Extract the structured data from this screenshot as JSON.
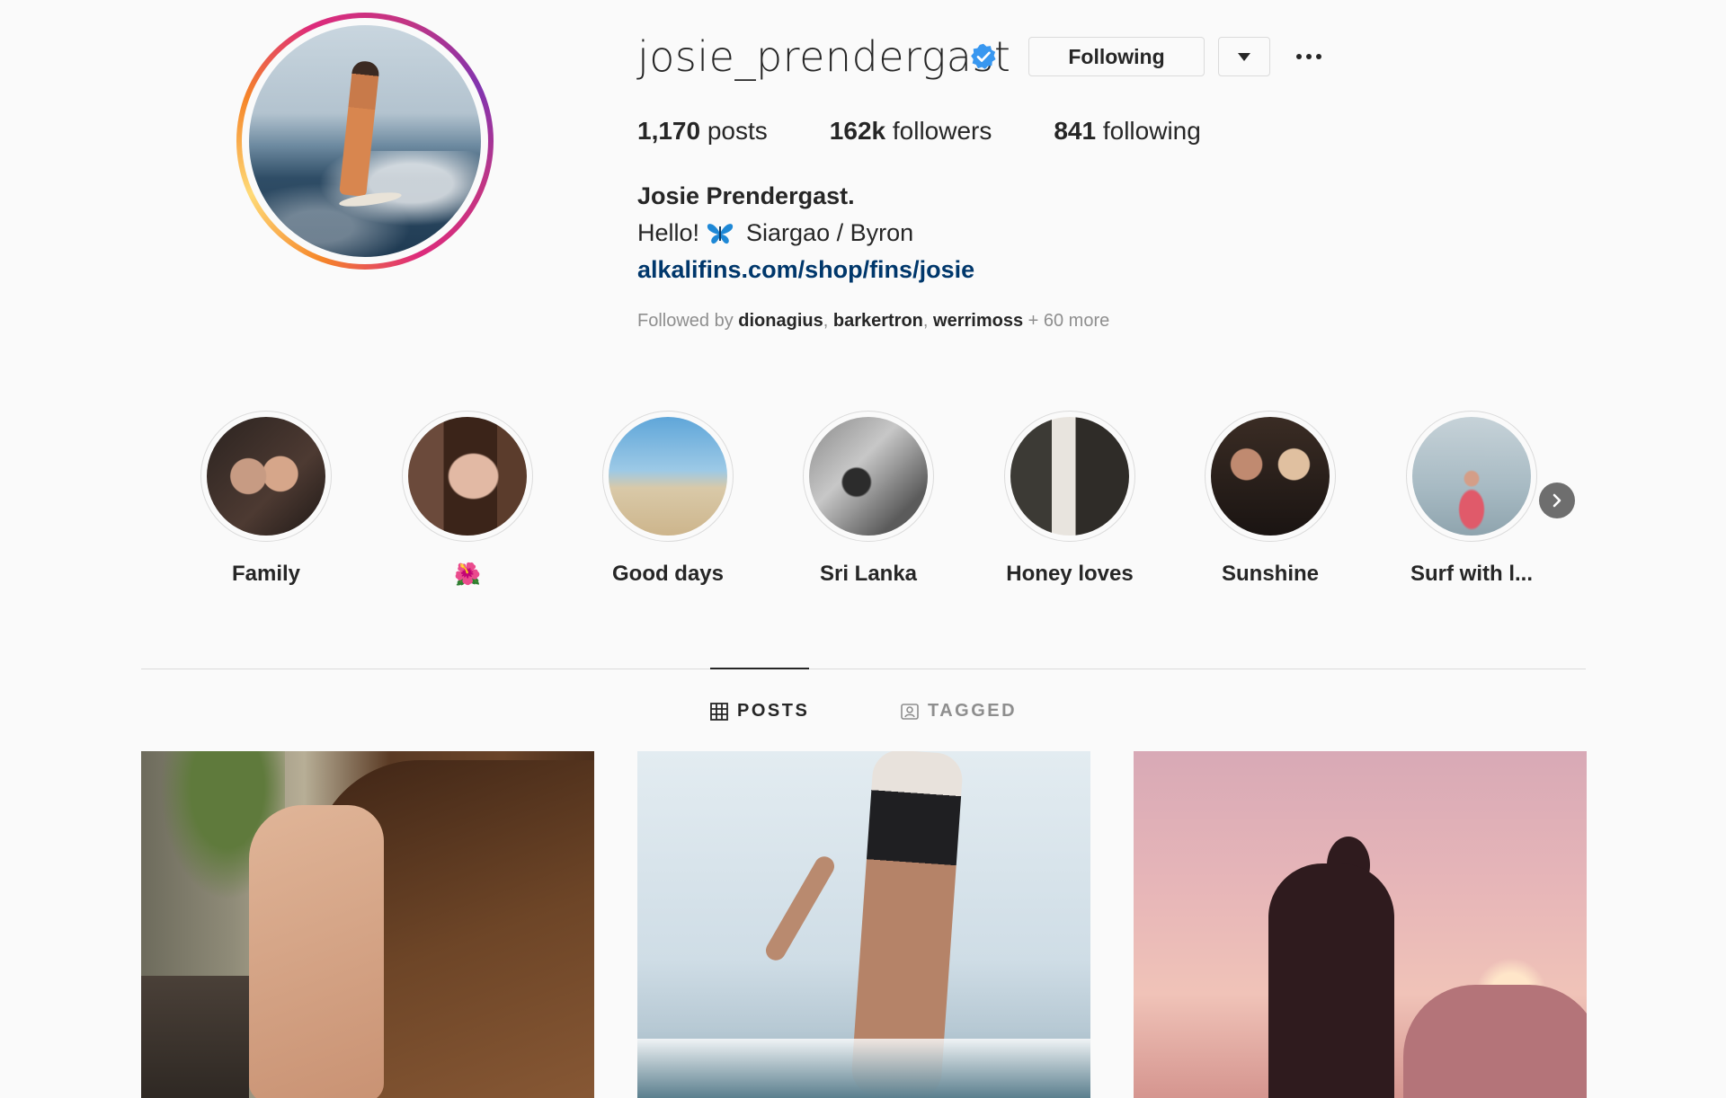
{
  "profile": {
    "username": "josie_prendergast",
    "verified": true,
    "following_button": "Following",
    "stats": {
      "posts_count": "1,170",
      "posts_label": "posts",
      "followers_count": "162k",
      "followers_label": "followers",
      "following_count": "841",
      "following_label": "following"
    },
    "full_name": "Josie Prendergast.",
    "bio_hello": "Hello!",
    "bio_location": "Siargao / Byron",
    "bio_link": "alkalifins.com/shop/fins/josie",
    "followed_by": {
      "prefix": "Followed by",
      "users": [
        "dionagius",
        "barkertron",
        "werrimoss"
      ],
      "more": "+ 60 more"
    }
  },
  "highlights": [
    {
      "label": "Family"
    },
    {
      "label": "🌺"
    },
    {
      "label": "Good days"
    },
    {
      "label": "Sri Lanka"
    },
    {
      "label": "Honey loves"
    },
    {
      "label": "Sunshine"
    },
    {
      "label": "Surf with l..."
    }
  ],
  "tabs": {
    "posts": "POSTS",
    "tagged": "TAGGED",
    "active": "posts"
  },
  "colors": {
    "link": "#00376b",
    "verified": "#3897f0",
    "text": "#262626",
    "muted": "#8e8e8e"
  }
}
